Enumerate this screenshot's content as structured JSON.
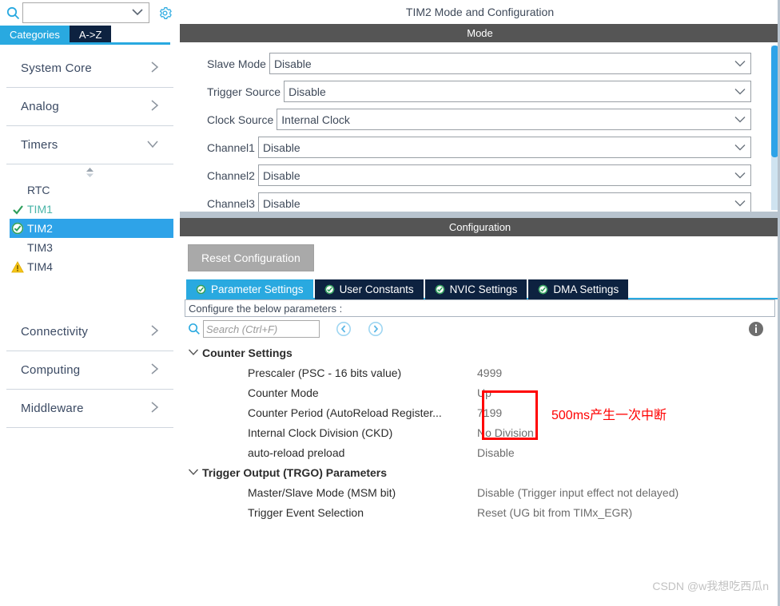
{
  "sidebar": {
    "search": {
      "value": "",
      "placeholder": "",
      "icon": "search-icon"
    },
    "gear_icon": "gear-icon",
    "tabs": [
      {
        "label": "Categories",
        "active": true
      },
      {
        "label": "A->Z",
        "active": false
      }
    ],
    "categories": [
      {
        "label": "System Core",
        "arrow": "›",
        "expanded": false
      },
      {
        "label": "Analog",
        "arrow": "›",
        "expanded": false
      },
      {
        "label": "Timers",
        "arrow": "⌄",
        "expanded": true
      }
    ],
    "peripherals": [
      {
        "label": "RTC",
        "status": "none",
        "selected": false
      },
      {
        "label": "TIM1",
        "status": "check",
        "selected": false
      },
      {
        "label": "TIM2",
        "status": "check-filled",
        "selected": true
      },
      {
        "label": "TIM3",
        "status": "none",
        "selected": false
      },
      {
        "label": "TIM4",
        "status": "warning",
        "selected": false
      }
    ],
    "categories_bottom": [
      {
        "label": "Connectivity",
        "arrow": "›"
      },
      {
        "label": "Computing",
        "arrow": "›"
      },
      {
        "label": "Middleware",
        "arrow": "›"
      }
    ]
  },
  "panel": {
    "title": "TIM2 Mode and Configuration",
    "mode_header": "Mode",
    "config_header": "Configuration"
  },
  "mode": {
    "rows": [
      {
        "label": "Slave Mode",
        "value": "Disable"
      },
      {
        "label": "Trigger Source",
        "value": "Disable"
      },
      {
        "label": "Clock Source",
        "value": "Internal Clock"
      },
      {
        "label": "Channel1",
        "value": "Disable"
      },
      {
        "label": "Channel2",
        "value": "Disable"
      },
      {
        "label": "Channel3",
        "value": "Disable"
      }
    ]
  },
  "configuration": {
    "reset_button": "Reset Configuration",
    "tabs": [
      {
        "label": "Parameter Settings",
        "active": true
      },
      {
        "label": "User Constants",
        "active": false
      },
      {
        "label": "NVIC Settings",
        "active": false
      },
      {
        "label": "DMA Settings",
        "active": false
      }
    ],
    "configure_line": "Configure the below parameters :",
    "search": {
      "placeholder": "Search (Ctrl+F)",
      "value": ""
    },
    "nav_prev_icon": "chevron-left-circle-icon",
    "nav_next_icon": "chevron-right-circle-icon",
    "info_icon": "info-icon",
    "groups": [
      {
        "name": "Counter Settings",
        "expanded": true,
        "rows": [
          {
            "name": "Prescaler (PSC - 16 bits value)",
            "value": "4999"
          },
          {
            "name": "Counter Mode",
            "value": "Up"
          },
          {
            "name": "Counter Period (AutoReload Register...",
            "value": "7199"
          },
          {
            "name": "Internal Clock Division (CKD)",
            "value": "No Division"
          },
          {
            "name": "auto-reload preload",
            "value": "Disable"
          }
        ]
      },
      {
        "name": "Trigger Output (TRGO) Parameters",
        "expanded": true,
        "rows": [
          {
            "name": "Master/Slave Mode (MSM bit)",
            "value": "Disable (Trigger input effect not delayed)"
          },
          {
            "name": "Trigger Event Selection",
            "value": "Reset (UG bit from TIMx_EGR)"
          }
        ]
      }
    ]
  },
  "annotation": {
    "text": "500ms产生一次中断",
    "color": "#ff0000"
  },
  "watermark": {
    "text": "CSDN @w我想吃西瓜n"
  },
  "colors": {
    "accent_blue": "#29a9e0",
    "dark_navy": "#0d2240",
    "section_gray": "#555555",
    "green_check": "#4ab5a8",
    "warning_yellow": "#f5c518",
    "red": "#ff0000"
  }
}
